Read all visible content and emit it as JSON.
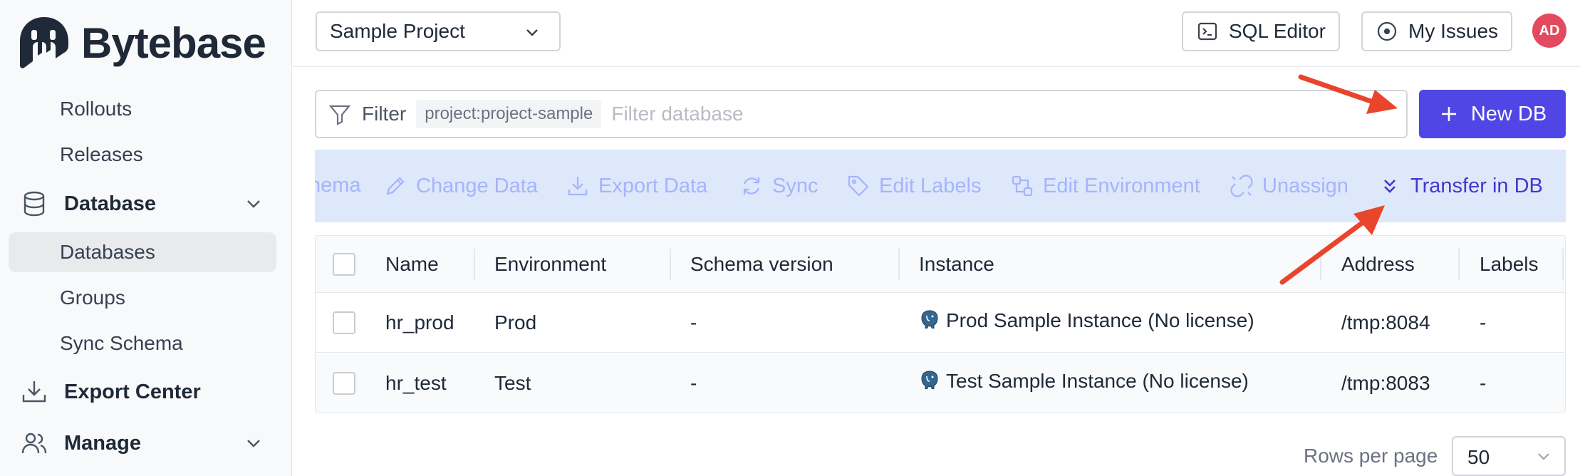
{
  "brand": {
    "name": "Bytebase"
  },
  "sidebar": {
    "items": [
      {
        "label": "Rollouts"
      },
      {
        "label": "Releases"
      },
      {
        "label": "Database"
      },
      {
        "label": "Databases"
      },
      {
        "label": "Groups"
      },
      {
        "label": "Sync Schema"
      },
      {
        "label": "Export Center"
      },
      {
        "label": "Manage"
      }
    ]
  },
  "header": {
    "project": "Sample Project",
    "sql_editor": "SQL Editor",
    "my_issues": "My Issues",
    "avatar_initials": "AD"
  },
  "filter": {
    "label": "Filter",
    "tag": "project:project-sample",
    "placeholder": "Filter database"
  },
  "new_db_label": "New DB",
  "actions": [
    {
      "label": "Sync Schema",
      "visible": "hema"
    },
    {
      "label": "Change Data"
    },
    {
      "label": "Export Data"
    },
    {
      "label": "Sync"
    },
    {
      "label": "Edit Labels"
    },
    {
      "label": "Edit Environment"
    },
    {
      "label": "Unassign"
    },
    {
      "label": "Transfer in DB"
    }
  ],
  "table": {
    "columns": [
      "Name",
      "Environment",
      "Schema version",
      "Instance",
      "Address",
      "Labels"
    ],
    "rows": [
      {
        "name": "hr_prod",
        "environment": "Prod",
        "schema_version": "-",
        "instance": "Prod Sample Instance (No license)",
        "address": "/tmp:8084",
        "labels": "-"
      },
      {
        "name": "hr_test",
        "environment": "Test",
        "schema_version": "-",
        "instance": "Test Sample Instance (No license)",
        "address": "/tmp:8083",
        "labels": "-"
      }
    ]
  },
  "pagination": {
    "label": "Rows per page",
    "value": "50"
  },
  "colors": {
    "accent": "#4f46e5",
    "action_bar": "#dde8fb",
    "arrow": "#e8452c",
    "avatar": "#e34a5f"
  }
}
